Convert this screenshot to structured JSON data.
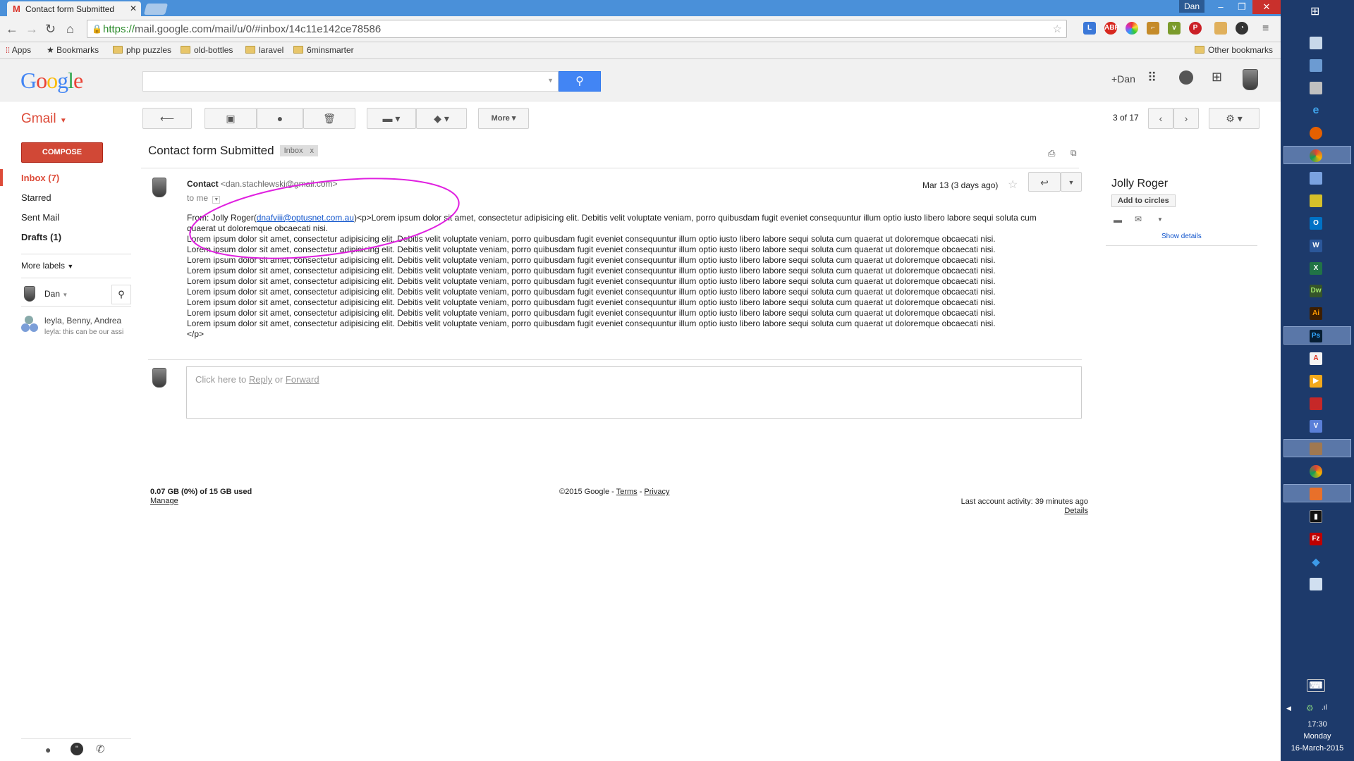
{
  "browser": {
    "tab_title": "Contact form Submitted",
    "window_user": "Dan",
    "url_https": "https://",
    "url_rest": "mail.google.com/mail/u/0/#inbox/14c11e142ce78586"
  },
  "bookmarks": {
    "items": [
      "Apps",
      "Bookmarks",
      "php puzzles",
      "old-bottles",
      "laravel",
      "6minsmarter"
    ],
    "other": "Other bookmarks"
  },
  "header": {
    "logo": "Google",
    "search_placeholder": "",
    "plus_user": "+Dan"
  },
  "toolbar": {
    "app_label": "Gmail",
    "more_label": "More",
    "pagination": "3 of 17"
  },
  "sidebar": {
    "compose_label": "COMPOSE",
    "items": [
      {
        "label": "Inbox (7)"
      },
      {
        "label": "Starred"
      },
      {
        "label": "Sent Mail"
      },
      {
        "label": "Drafts (1)"
      }
    ],
    "more_labels": "More labels",
    "chat_user": "Dan",
    "hangout_title": "leyla, Benny, Andrea",
    "hangout_snippet": "leyla: this can be our assi"
  },
  "message": {
    "subject": "Contact form Submitted",
    "label": "Inbox",
    "label_remove": "x",
    "sender_name": "Contact",
    "sender_email": "<dan.stachlewski@gmail.com>",
    "to": "to me",
    "date": "Mar 13 (3 days ago)",
    "from_prefix": "From: Jolly Roger(",
    "from_email": "dnafviii@optusnet.com.au",
    "first_line_rest": ")<p>Lorem ipsum dolor sit amet, consectetur adipisicing elit. Debitis velit voluptate veniam, porro quibusdam fugit eveniet consequuntur illum optio iusto libero labore sequi soluta cum quaerat ut doloremque obcaecati nisi.",
    "lorem": "Lorem ipsum dolor sit amet, consectetur adipisicing elit. Debitis velit voluptate veniam, porro quibusdam fugit eveniet consequuntur illum optio iusto libero labore sequi soluta cum quaerat ut doloremque obcaecati nisi.",
    "closing_tag": "</p>"
  },
  "reply": {
    "prefix": "Click here to ",
    "reply_link": "Reply",
    "or": " or ",
    "forward_link": "Forward"
  },
  "footer": {
    "storage": "0.07 GB (0%) of 15 GB used",
    "manage": "Manage",
    "copyright": "©2015 Google - ",
    "terms": "Terms",
    "dash": " - ",
    "privacy": "Privacy",
    "activity": "Last account activity: 39 minutes ago",
    "details": "Details"
  },
  "contact_card": {
    "name": "Jolly Roger",
    "add_to_circles": "Add to circles",
    "show_details": "Show details"
  },
  "taskbar": {
    "time": "17:30",
    "day": "Monday",
    "date": "16-March-2015"
  },
  "colors": {
    "gmail_red": "#dd4b39",
    "search_blue": "#4285f4",
    "annotation_magenta": "#e020e0"
  }
}
